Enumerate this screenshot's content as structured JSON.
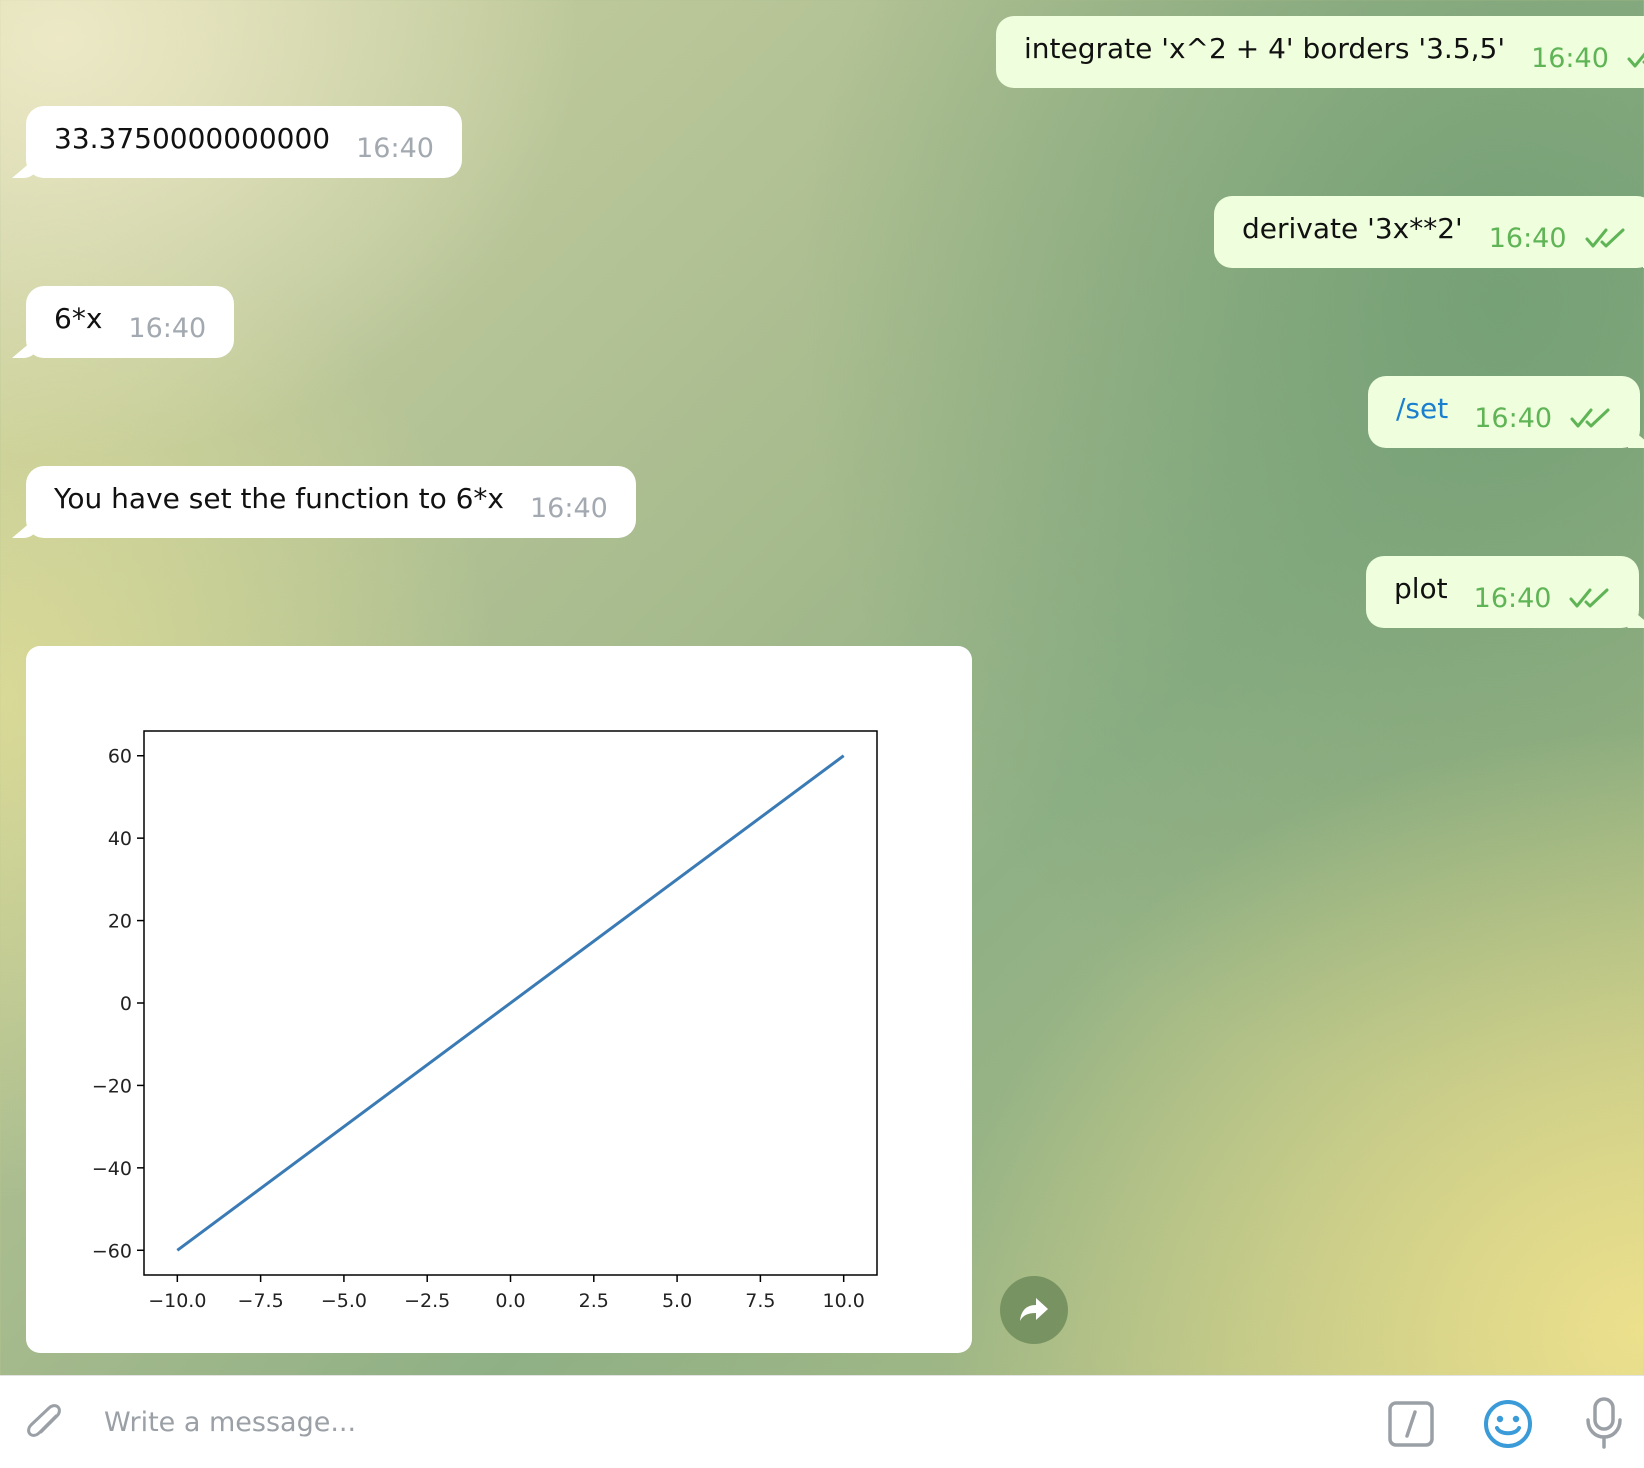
{
  "messages": [
    {
      "side": "out",
      "text": "integrate 'x^2 + 4' borders '3.5,5'",
      "time": "16:40",
      "status": "read"
    },
    {
      "side": "in",
      "text": "33.3750000000000",
      "time": "16:40"
    },
    {
      "side": "out",
      "text": "derivate '3x**2'",
      "time": "16:40",
      "status": "read"
    },
    {
      "side": "in",
      "text": "6*x",
      "time": "16:40"
    },
    {
      "side": "out",
      "text": "/set",
      "time": "16:40",
      "status": "read",
      "is_command": true
    },
    {
      "side": "in",
      "text": "You have set the function to 6*x",
      "time": "16:40"
    },
    {
      "side": "out",
      "text": "plot",
      "time": "16:40",
      "status": "read"
    }
  ],
  "chart_data": {
    "type": "line",
    "title": "",
    "xlabel": "",
    "ylabel": "",
    "xlim": [
      -11.0,
      11.0
    ],
    "ylim": [
      -66.0,
      66.0
    ],
    "xticks": [
      -10.0,
      -7.5,
      -5.0,
      -2.5,
      0.0,
      2.5,
      5.0,
      7.5,
      10.0
    ],
    "xtick_labels": [
      "−10.0",
      "−7.5",
      "−5.0",
      "−2.5",
      "0.0",
      "2.5",
      "5.0",
      "7.5",
      "10.0"
    ],
    "yticks": [
      60,
      40,
      20,
      0,
      -20,
      -40,
      -60
    ],
    "ytick_labels": [
      "60",
      "40",
      "20",
      "0",
      "−20",
      "−40",
      "−60"
    ],
    "grid": false,
    "series": [
      {
        "x": [
          -10,
          10
        ],
        "y": [
          -60,
          60
        ],
        "color": "#3a7bb5"
      }
    ]
  },
  "composer": {
    "placeholder": "Write a message..."
  },
  "colors": {
    "out_bubble": "#effedd",
    "in_bubble": "#ffffff",
    "out_time": "#5fb456",
    "in_time": "#a3a9b0",
    "command_link": "#1a7fcf",
    "icon_gray": "#9aa0a6",
    "emoji_blue": "#3a9bd8"
  },
  "icons": {
    "attach": "paperclip-icon",
    "share": "share-arrow-icon",
    "command": "slash-command-icon",
    "emoji": "smile-icon",
    "mic": "microphone-icon",
    "read": "double-check-icon"
  }
}
